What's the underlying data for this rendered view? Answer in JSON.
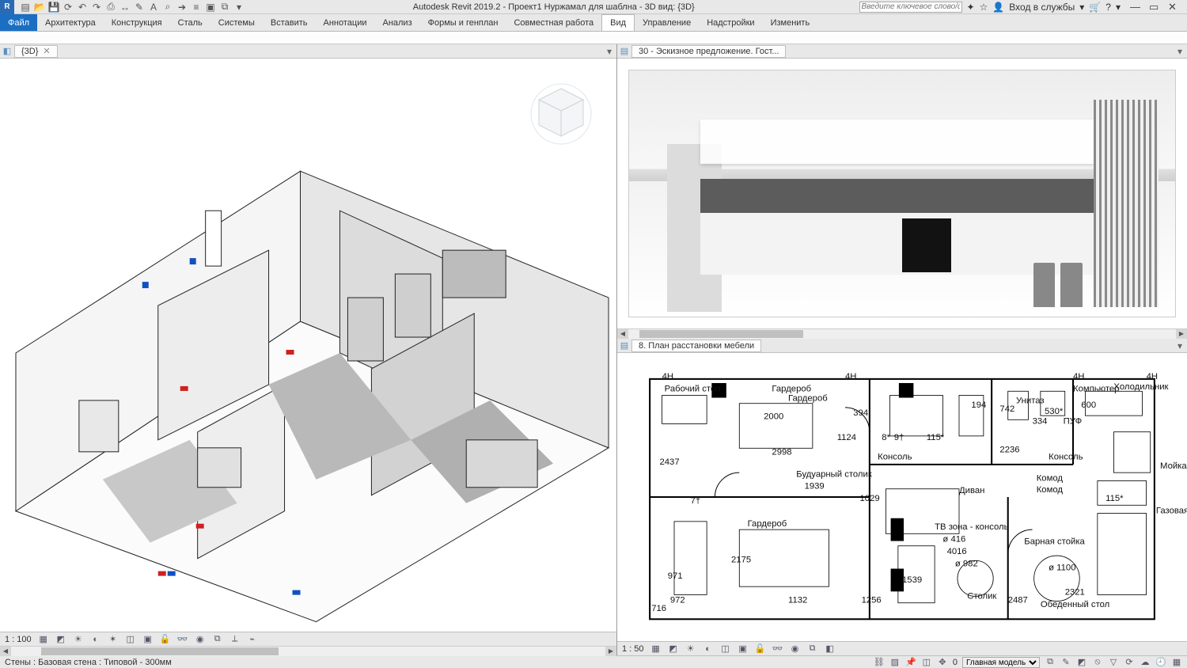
{
  "app": {
    "logo_letter": "R",
    "title": "Autodesk Revit 2019.2 - Проект1 Нуржамал для шаблна - 3D вид: {3D}",
    "search_placeholder": "Введите ключевое слово/фразу",
    "signin_label": "Вход в службы"
  },
  "qat_icons": [
    "file-icon",
    "open-icon",
    "save-icon",
    "sync-icon",
    "undo-icon",
    "redo-icon",
    "print-icon",
    "dim-icon",
    "measure-icon",
    "text-icon",
    "fit-icon",
    "arrow-icon",
    "thin-lines-icon",
    "close-hidden-icon",
    "switch-windows-icon",
    "dropdown-icon"
  ],
  "titlebar_right_icons": [
    "communicate-icon",
    "favorites-icon",
    "user-icon",
    "cart-icon",
    "help-icon"
  ],
  "window_controls": [
    "minimize-icon",
    "restore-icon",
    "close-icon"
  ],
  "ribbon": {
    "file": "Файл",
    "tabs": [
      "Архитектура",
      "Конструкция",
      "Сталь",
      "Системы",
      "Вставить",
      "Аннотации",
      "Анализ",
      "Формы и генплан",
      "Совместная работа",
      "Вид",
      "Управление",
      "Надстройки",
      "Изменить"
    ],
    "active": "Вид"
  },
  "views": {
    "left": {
      "tab": "{3D}",
      "scale": "1 : 100"
    },
    "right_top": {
      "tab": "30 - Эскизное предложение. Гост..."
    },
    "right_bottom": {
      "tab": "8. План расстановки мебели",
      "scale": "1 : 50"
    }
  },
  "viewbar_icons": [
    "detail-level-icon",
    "visual-style-icon",
    "sun-icon",
    "shadows-icon",
    "render-icon",
    "crop-view-icon",
    "crop-region-icon",
    "unlock-icon",
    "temp-hide-icon",
    "reveal-icon",
    "worksharing-icon",
    "constraints-icon",
    "analytical-icon"
  ],
  "floorplan_labels": [
    "Рабочий стол",
    "Гардероб",
    "Гардероб",
    "Унитаз",
    "Холодильник",
    "Комод",
    "Мойка",
    "Диван",
    "Комод",
    "Консоль",
    "Консоль",
    "ТВ зона - консоль",
    "Столик",
    "Барная стойка",
    "Гардероб",
    "Будуарный столик",
    "Обеденный стол",
    "Газовая плита с духовкой",
    "ПУФ",
    "Компьютер"
  ],
  "floorplan_dims": [
    "2000",
    "2437",
    "2998",
    "1939",
    "1029",
    "1124",
    "394",
    "971",
    "2175",
    "1132",
    "1256",
    "2487",
    "972",
    "2236",
    "4H",
    "4H",
    "4H",
    "4H",
    "ø 982",
    "ø 1100",
    "ø 416",
    "4016",
    "8*",
    "9†",
    "7†",
    "716",
    "600",
    "1539",
    "115*",
    "115*",
    "194",
    "2321",
    "530*",
    "334",
    "742"
  ],
  "status": {
    "left_text": "Стены : Базовая стена : Типовой - 300мм",
    "model_selector": "Главная модель",
    "progress": "0"
  },
  "status_icons_left": [
    "select-links-icon",
    "select-underlay-icon",
    "select-pinned-icon",
    "select-face-icon",
    "drag-icon"
  ],
  "status_icons_right": [
    "workset-icon",
    "editable-only-icon",
    "design-options-icon",
    "exclude-icon",
    "filter-icon",
    "sync-icon",
    "cloud-icon",
    "temp-icon",
    "reveal-icon"
  ]
}
